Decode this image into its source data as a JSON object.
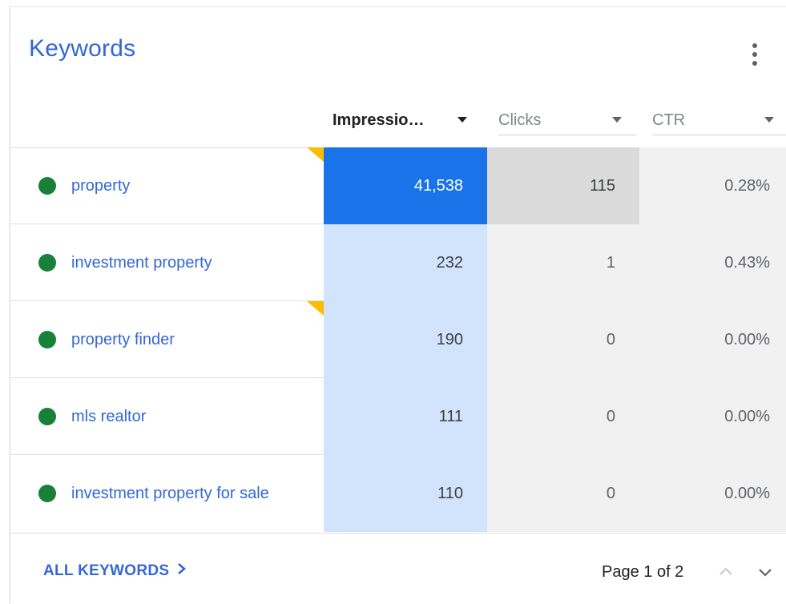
{
  "card": {
    "title": "Keywords",
    "menu_icon": "more-vert-icon"
  },
  "columns": {
    "impressions": "Impressio…",
    "clicks": "Clicks",
    "ctr": "CTR"
  },
  "rows": [
    {
      "keyword": "property",
      "impressions": "41,538",
      "clicks": "115",
      "ctr": "0.28%",
      "status": "active",
      "flagged": true,
      "highlighted": true
    },
    {
      "keyword": "investment property",
      "impressions": "232",
      "clicks": "1",
      "ctr": "0.43%",
      "status": "active",
      "flagged": false,
      "highlighted": false
    },
    {
      "keyword": "property finder",
      "impressions": "190",
      "clicks": "0",
      "ctr": "0.00%",
      "status": "active",
      "flagged": true,
      "highlighted": false
    },
    {
      "keyword": "mls realtor",
      "impressions": "111",
      "clicks": "0",
      "ctr": "0.00%",
      "status": "active",
      "flagged": false,
      "highlighted": false
    },
    {
      "keyword": "investment property for sale",
      "impressions": "110",
      "clicks": "0",
      "ctr": "0.00%",
      "status": "active",
      "flagged": false,
      "highlighted": false
    }
  ],
  "footer": {
    "all_keywords": "ALL KEYWORDS",
    "page_text": "Page 1 of 2"
  },
  "colors": {
    "accent": "#3367d6",
    "status_active": "#188038",
    "highlight_cell": "#1a73e8",
    "impressions_column": "#d2e3fc",
    "flag": "#fbbc04"
  }
}
